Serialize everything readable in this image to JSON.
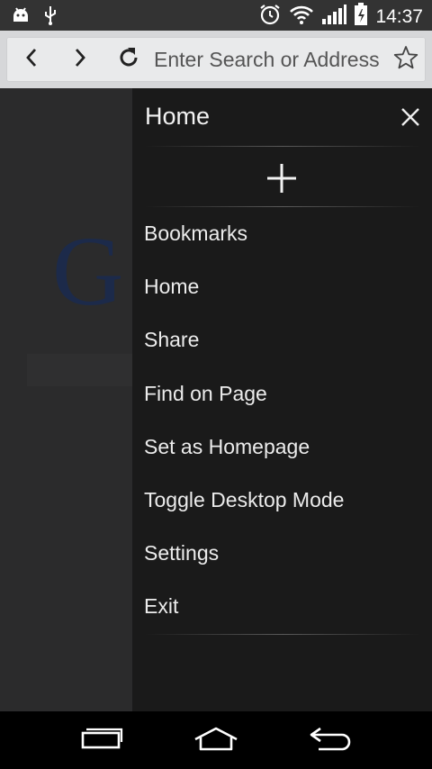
{
  "status_bar": {
    "time": "14:37",
    "icons": [
      "android-debug-icon",
      "usb-icon",
      "alarm-icon",
      "wifi-icon",
      "signal-icon",
      "battery-charging-icon"
    ]
  },
  "url_bar": {
    "placeholder": "Enter Search or Address",
    "icons": [
      "back-icon",
      "forward-icon",
      "reload-icon",
      "star-icon"
    ]
  },
  "background_page": {
    "logo_letter": "G"
  },
  "drawer": {
    "title": "Home",
    "items": [
      {
        "label": "Bookmarks"
      },
      {
        "label": "Home"
      },
      {
        "label": "Share"
      },
      {
        "label": "Find on Page"
      },
      {
        "label": "Set as Homepage"
      },
      {
        "label": "Toggle Desktop Mode"
      },
      {
        "label": "Settings"
      },
      {
        "label": "Exit"
      }
    ]
  },
  "nav_bar": {
    "icons": [
      "recent-apps-icon",
      "home-icon",
      "back-nav-icon"
    ]
  }
}
